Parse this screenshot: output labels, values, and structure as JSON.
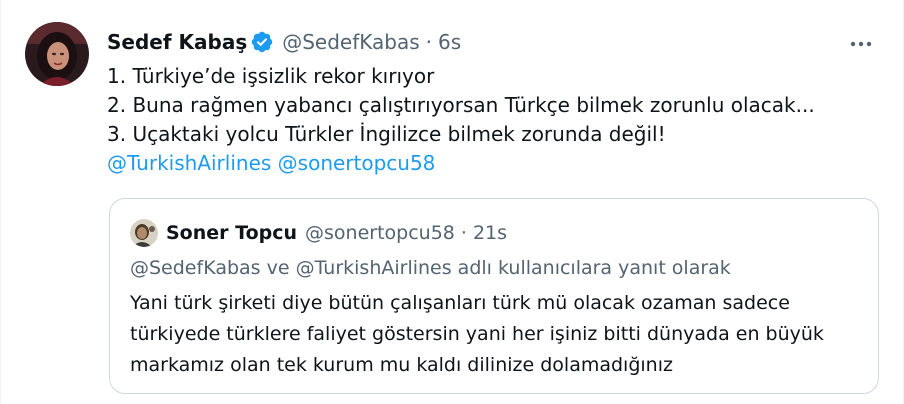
{
  "tweet": {
    "author_name": "Sedef Kabaş",
    "author_handle": "@SedefKabas",
    "separator": "·",
    "time": "6s",
    "lines": [
      "1. Türkiye’de işsizlik rekor kırıyor",
      "2. Buna rağmen yabancı çalıştırıyorsan Türkçe bilmek zorunlu olacak...",
      "3. Uçaktaki yolcu Türkler İngilizce bilmek zorunda değil!"
    ],
    "mentions": [
      "@TurkishAirlines",
      "@sonertopcu58"
    ],
    "verified_icon": "verified-badge-icon",
    "more_icon": "more-options-icon"
  },
  "quote": {
    "author_name": "Soner Topcu",
    "author_handle": "@sonertopcu58",
    "separator": "·",
    "time": "21s",
    "reply_context": "@SedefKabas ve @TurkishAirlines adlı kullanıcılara yanıt olarak",
    "lines": [
      "Yani türk şirketi diye bütün çalışanları türk mü olacak ozaman sadece",
      "türkiyede türklere faliyet göstersin yani her işiniz bitti dünyada en büyük",
      "markamız olan tek kurum mu kaldı dilinize dolamadığınız"
    ]
  },
  "colors": {
    "accent": "#1d9bf0",
    "text": "#0f1419",
    "secondary": "#536471",
    "border": "#cfd9de"
  }
}
